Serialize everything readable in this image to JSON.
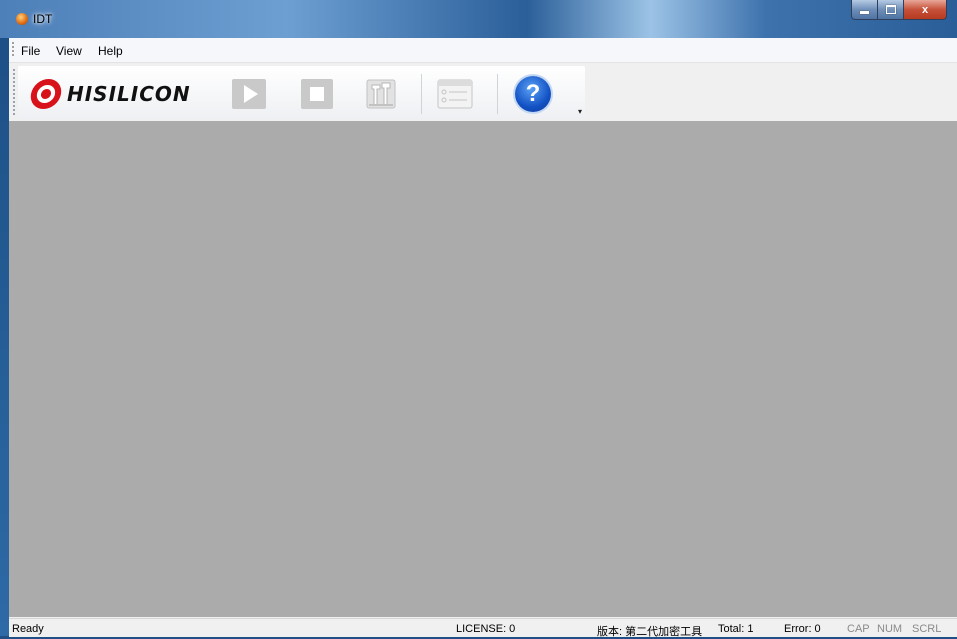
{
  "window": {
    "title": "IDT"
  },
  "caption": {
    "close_glyph": "x"
  },
  "menu": {
    "items": [
      "File",
      "View",
      "Help"
    ]
  },
  "toolbar": {
    "logo_text": "HISILICON",
    "buttons": [
      "start-icon",
      "stop-icon",
      "tools-icon",
      "settings-window-icon",
      "help-icon"
    ],
    "help_glyph": "?",
    "overflow_glyph": "▾"
  },
  "status": {
    "ready": "Ready",
    "license": "LICENSE: 0",
    "version": "版本: 第二代加密工具",
    "total": "Total: 1",
    "error": "Error: 0",
    "cap": "CAP",
    "num": "NUM",
    "scrl": "SCRL"
  },
  "colors": {
    "workspace": "#ababab",
    "logo_red": "#d8121a",
    "help_blue": "#1352c4"
  }
}
